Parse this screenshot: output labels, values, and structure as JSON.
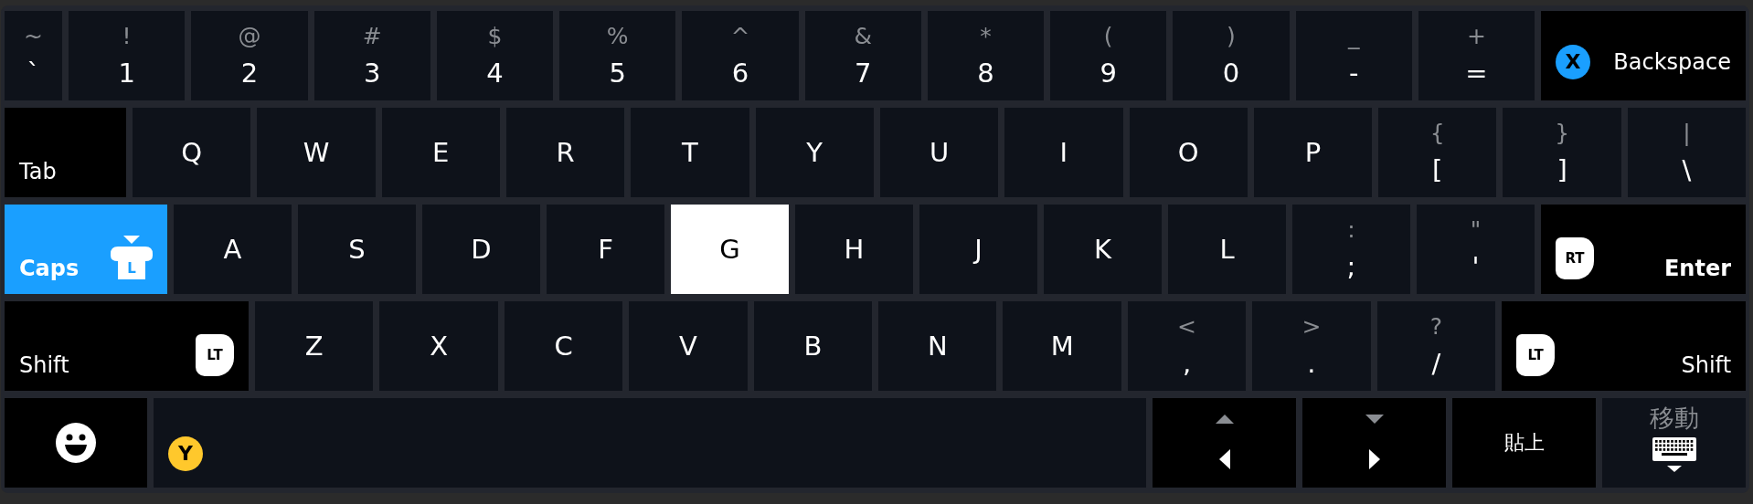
{
  "keyboard": {
    "rows": [
      {
        "keys": [
          {
            "kind": "narrow_char",
            "main": "`",
            "shift": "~",
            "selected": false
          },
          {
            "kind": "char",
            "main": "1",
            "shift": "!",
            "selected": false
          },
          {
            "kind": "char",
            "main": "2",
            "shift": "@",
            "selected": false
          },
          {
            "kind": "char",
            "main": "3",
            "shift": "#",
            "selected": false
          },
          {
            "kind": "char",
            "main": "4",
            "shift": "$",
            "selected": false
          },
          {
            "kind": "char",
            "main": "5",
            "shift": "%",
            "selected": false
          },
          {
            "kind": "char",
            "main": "6",
            "shift": "^",
            "selected": false
          },
          {
            "kind": "char",
            "main": "7",
            "shift": "&",
            "selected": false
          },
          {
            "kind": "char",
            "main": "8",
            "shift": "*",
            "selected": false
          },
          {
            "kind": "char",
            "main": "9",
            "shift": "(",
            "selected": false
          },
          {
            "kind": "char",
            "main": "0",
            "shift": ")",
            "selected": false
          },
          {
            "kind": "char",
            "main": "-",
            "shift": "_",
            "selected": false
          },
          {
            "kind": "char",
            "main": "=",
            "shift": "+",
            "selected": false
          },
          {
            "kind": "backspace",
            "label": "Backspace",
            "hint_before": {
              "kind": "round",
              "label": "X",
              "color": "#1a9fff"
            },
            "selected": false
          }
        ]
      },
      {
        "keys": [
          {
            "kind": "tab",
            "label": "Tab",
            "selected": false
          },
          {
            "kind": "char",
            "main": "Q",
            "selected": false
          },
          {
            "kind": "char",
            "main": "W",
            "selected": false
          },
          {
            "kind": "char",
            "main": "E",
            "selected": false
          },
          {
            "kind": "char",
            "main": "R",
            "selected": false
          },
          {
            "kind": "char",
            "main": "T",
            "selected": false
          },
          {
            "kind": "char",
            "main": "Y",
            "selected": false
          },
          {
            "kind": "char",
            "main": "U",
            "selected": false
          },
          {
            "kind": "char",
            "main": "I",
            "selected": false
          },
          {
            "kind": "char",
            "main": "O",
            "selected": false
          },
          {
            "kind": "char",
            "main": "P",
            "selected": false
          },
          {
            "kind": "char",
            "main": "[",
            "shift": "{",
            "selected": false
          },
          {
            "kind": "char",
            "main": "]",
            "shift": "}",
            "selected": false
          },
          {
            "kind": "char",
            "main": "\\",
            "shift": "|",
            "selected": false
          }
        ]
      },
      {
        "keys": [
          {
            "kind": "caps",
            "label": "Caps",
            "on": true,
            "hint_after": {
              "kind": "bumper",
              "label": "L"
            },
            "selected": false
          },
          {
            "kind": "char",
            "main": "A",
            "selected": false
          },
          {
            "kind": "char",
            "main": "S",
            "selected": false
          },
          {
            "kind": "char",
            "main": "D",
            "selected": false
          },
          {
            "kind": "char",
            "main": "F",
            "selected": false
          },
          {
            "kind": "char",
            "main": "G",
            "selected": true
          },
          {
            "kind": "char",
            "main": "H",
            "selected": false
          },
          {
            "kind": "char",
            "main": "J",
            "selected": false
          },
          {
            "kind": "char",
            "main": "K",
            "selected": false
          },
          {
            "kind": "char",
            "main": "L",
            "selected": false
          },
          {
            "kind": "char",
            "main": ";",
            "shift": ":",
            "selected": false
          },
          {
            "kind": "char",
            "main": "'",
            "shift": "\"",
            "selected": false
          },
          {
            "kind": "enter",
            "label": "Enter",
            "hint_before": {
              "kind": "trigger",
              "label": "RT"
            },
            "selected": false
          }
        ]
      },
      {
        "keys": [
          {
            "kind": "shift",
            "label": "Shift",
            "on": false,
            "hint_after": {
              "kind": "trigger",
              "label": "LT"
            },
            "selected": false
          },
          {
            "kind": "char",
            "main": "Z",
            "selected": false
          },
          {
            "kind": "char",
            "main": "X",
            "selected": false
          },
          {
            "kind": "char",
            "main": "C",
            "selected": false
          },
          {
            "kind": "char",
            "main": "V",
            "selected": false
          },
          {
            "kind": "char",
            "main": "B",
            "selected": false
          },
          {
            "kind": "char",
            "main": "N",
            "selected": false
          },
          {
            "kind": "char",
            "main": "M",
            "selected": false
          },
          {
            "kind": "char",
            "main": ",",
            "shift": "<",
            "selected": false
          },
          {
            "kind": "char",
            "main": ".",
            "shift": ">",
            "selected": false
          },
          {
            "kind": "char",
            "main": "/",
            "shift": "?",
            "selected": false
          },
          {
            "kind": "shift",
            "label": "Shift",
            "on": false,
            "hint_before": {
              "kind": "trigger",
              "label": "LT"
            },
            "selected": false
          }
        ]
      },
      {
        "keys": [
          {
            "kind": "emoji",
            "selected": false
          },
          {
            "kind": "space",
            "hint_before": {
              "kind": "round",
              "label": "Y",
              "color": "#ffc82c"
            },
            "selected": false
          },
          {
            "kind": "arrow_left",
            "selected": false
          },
          {
            "kind": "arrow_right",
            "selected": false
          },
          {
            "kind": "paste",
            "label": "貼上",
            "selected": false
          },
          {
            "kind": "move",
            "label": "移動",
            "selected": false
          }
        ]
      }
    ]
  }
}
